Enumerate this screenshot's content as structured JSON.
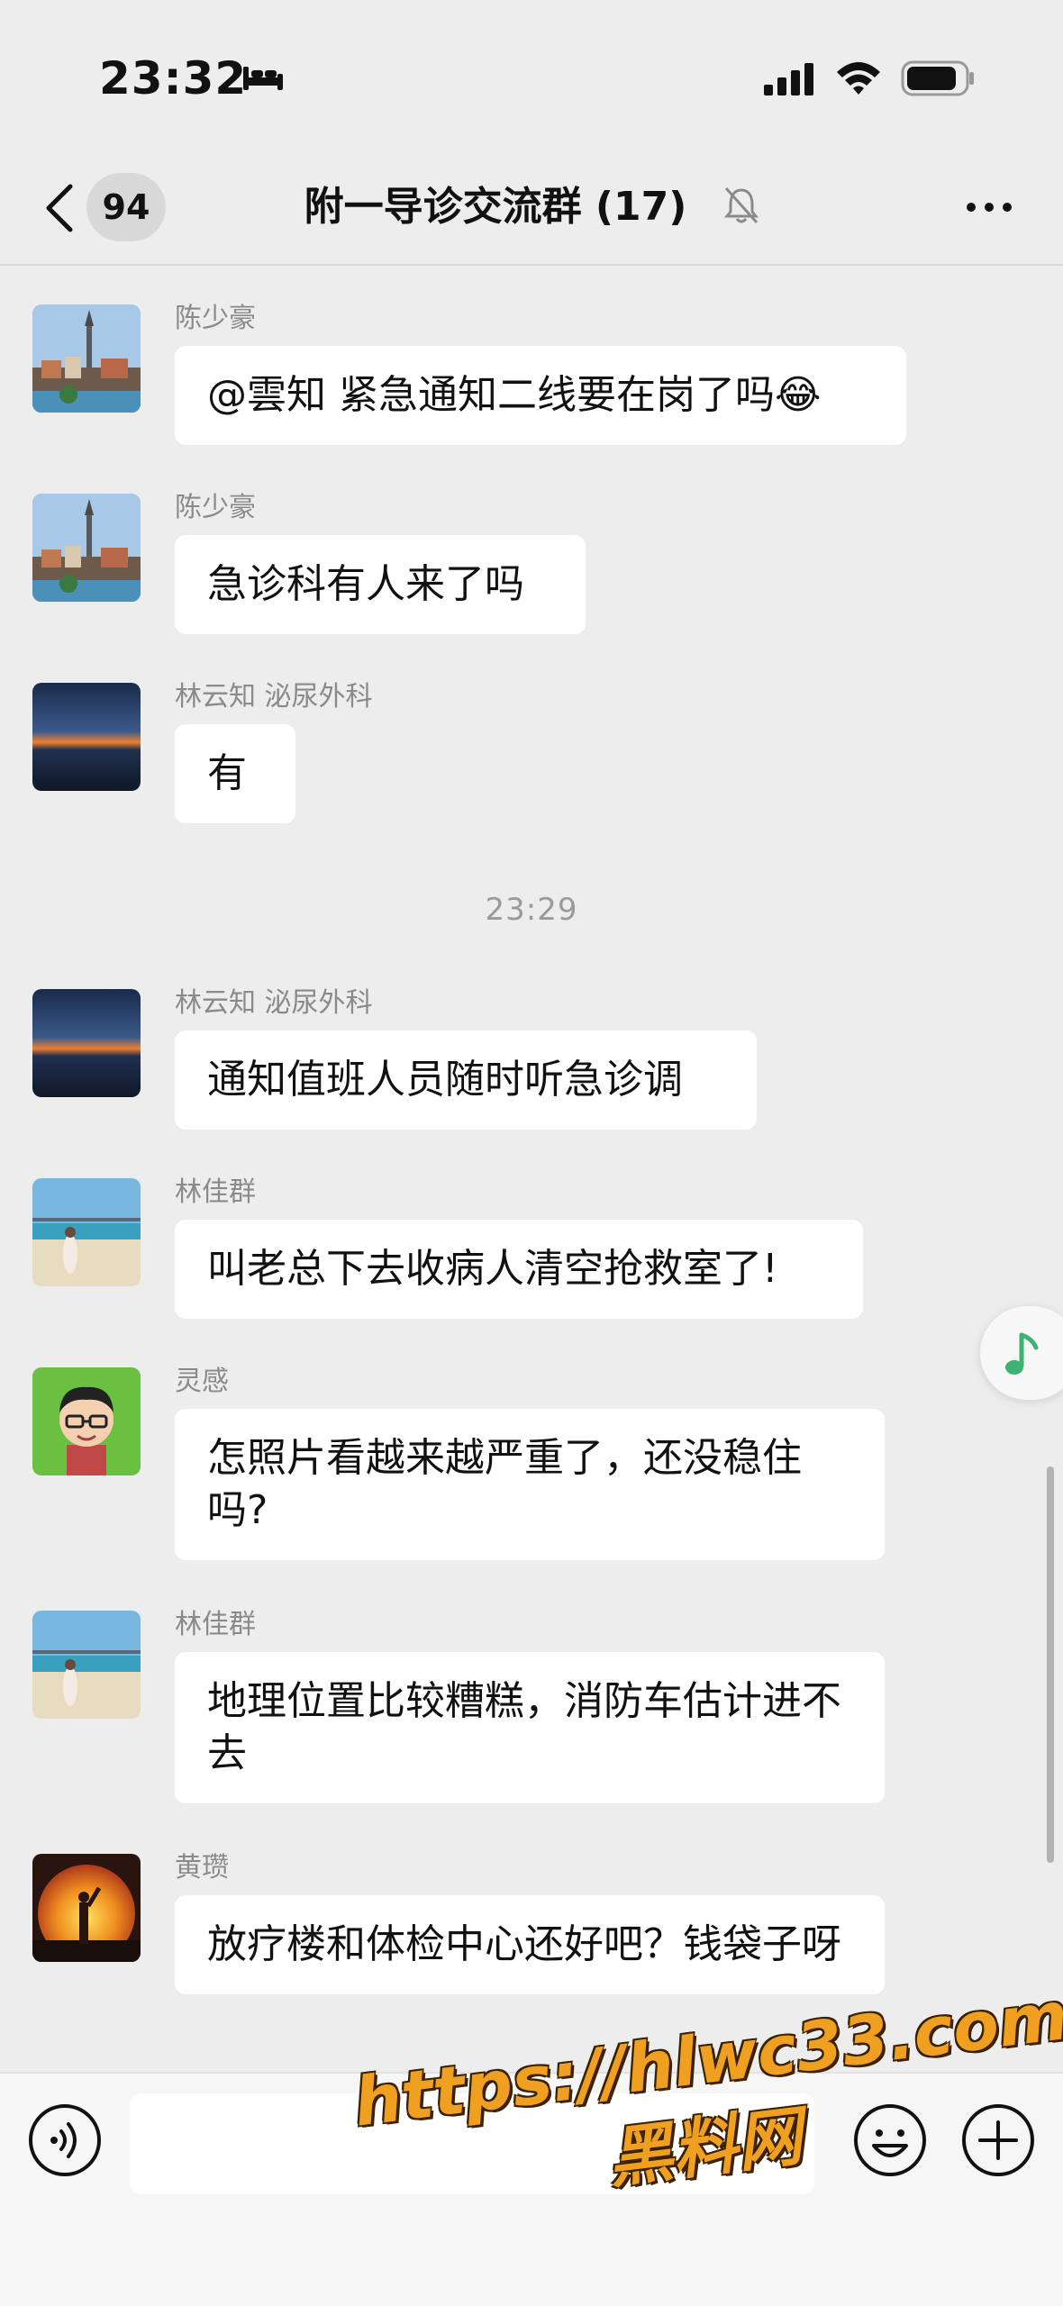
{
  "status_bar": {
    "time": "23:32",
    "icons": [
      "bed-icon",
      "signal-icon",
      "wifi-icon",
      "battery-icon"
    ]
  },
  "nav": {
    "back_icon": "chevron-left-icon",
    "unread_count": "94",
    "title": "附一导诊交流群 (17)",
    "muted_icon": "bell-slash-icon",
    "more_icon": "ellipsis-icon"
  },
  "messages": [
    {
      "sender": "陈少豪",
      "text": "@雲知 紧急通知二线要在岗了吗😂"
    },
    {
      "sender": "陈少豪",
      "text": "急诊科有人来了吗"
    },
    {
      "sender": "林云知 泌尿外科",
      "text": "有"
    },
    {
      "sender": "林云知 泌尿外科",
      "text": "通知值班人员随时听急诊调"
    },
    {
      "sender": "林佳群",
      "text": "叫老总下去收病人清空抢救室了!"
    },
    {
      "sender": "灵感",
      "text": "怎照片看越来越严重了，还没稳住吗?"
    },
    {
      "sender": "林佳群",
      "text": "地理位置比较糟糕，消防车估计进不去"
    },
    {
      "sender": "黄瓒",
      "text": "放疗楼和体检中心还好吧？钱袋子呀"
    }
  ],
  "time_divider": "23:29",
  "input_bar": {
    "voice_icon": "voice-icon",
    "message_value": "",
    "emoji_icon": "emoji-icon",
    "plus_icon": "plus-icon"
  },
  "floating": {
    "music_icon": "music-note-icon"
  },
  "watermark": {
    "url": "https://hlwc33.com",
    "name": "黑料网"
  },
  "colors": {
    "background": "#ededed",
    "bubble": "#ffffff",
    "accent": "#3cb371",
    "watermark": "#f0a020"
  }
}
